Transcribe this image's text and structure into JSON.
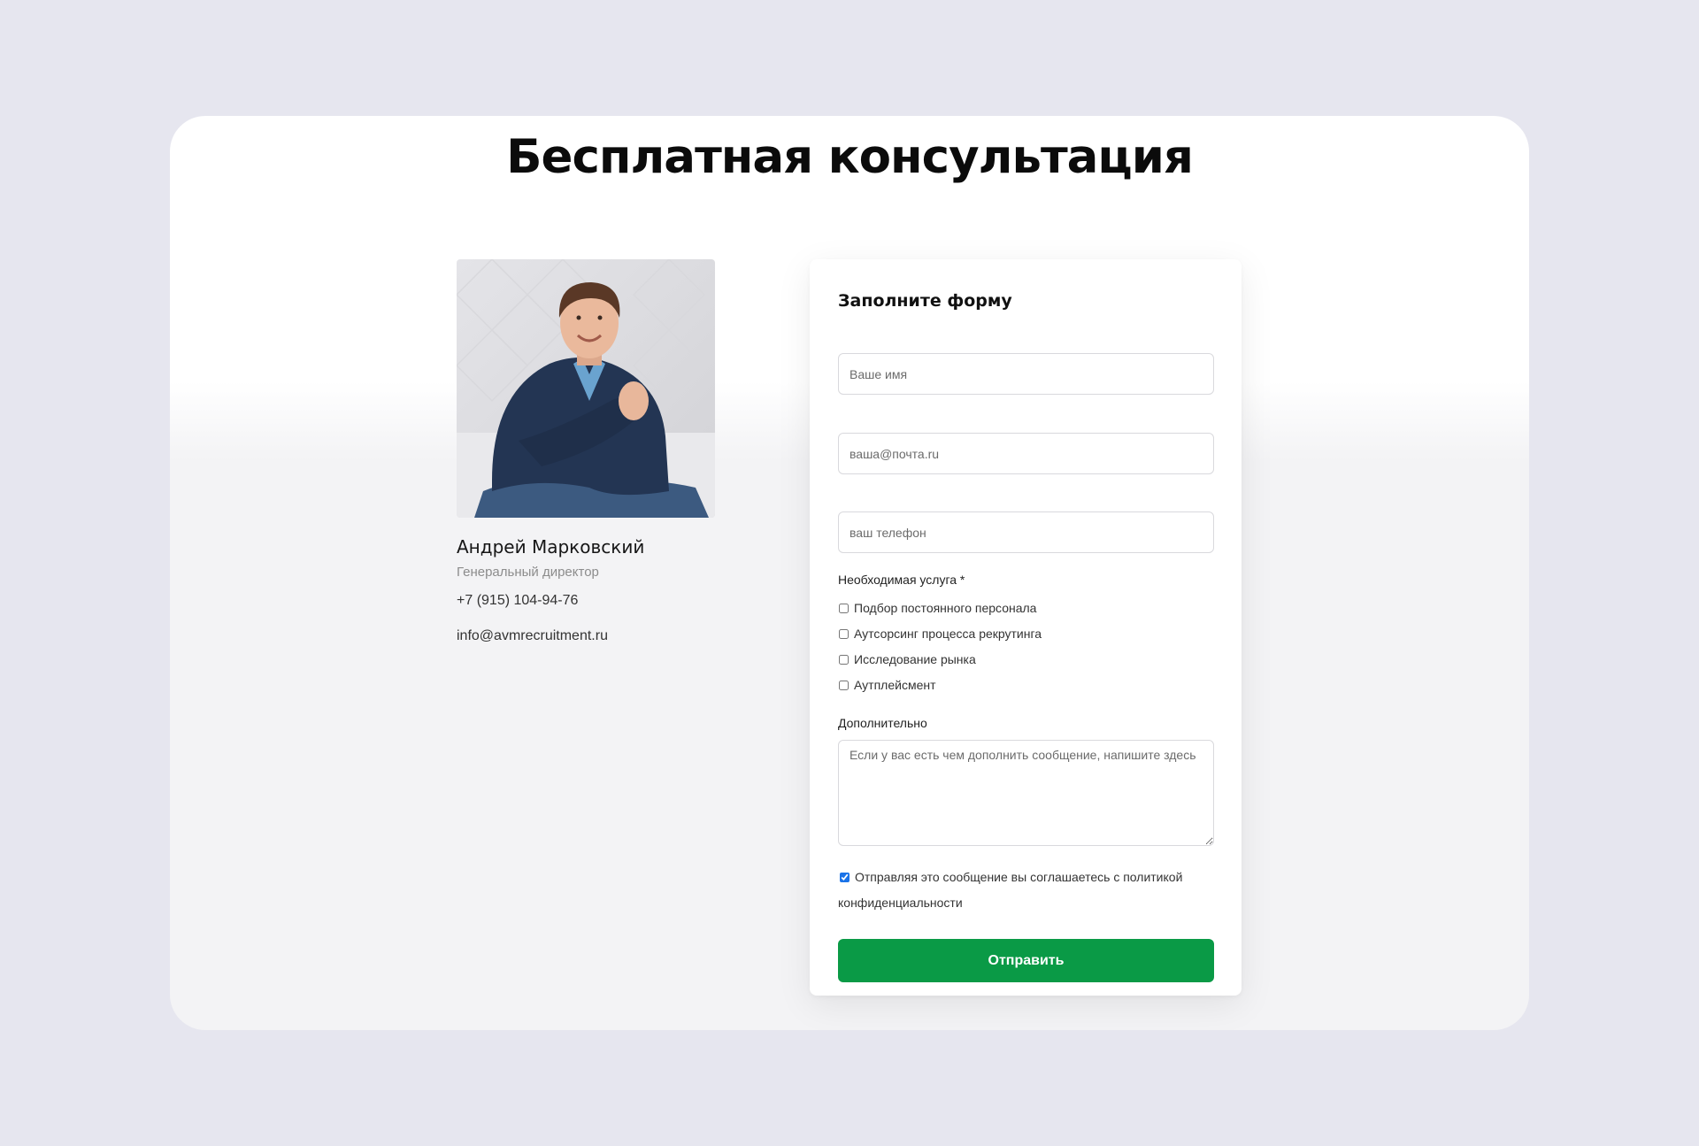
{
  "page": {
    "title": "Бесплатная консультация"
  },
  "person": {
    "name": "Андрей Марковский",
    "role": "Генеральный директор",
    "phone": "+7 (915) 104-94-76",
    "email": "info@avmrecruitment.ru"
  },
  "form": {
    "title": "Заполните форму",
    "name_placeholder": "Ваше имя",
    "email_placeholder": "ваша@почта.ru",
    "phone_placeholder": "ваш телефон",
    "service_label": "Необходимая услуга *",
    "services": [
      {
        "label": "Подбор постоянного персонала",
        "checked": false
      },
      {
        "label": "Аутсорсинг процесса рекрутинга",
        "checked": false
      },
      {
        "label": "Исследование рынка",
        "checked": false
      },
      {
        "label": "Аутплейсмент",
        "checked": false
      }
    ],
    "extra_label": "Дополнительно",
    "extra_placeholder": "Если у вас есть чем дополнить сообщение, напишите здесь",
    "consent_text": "Отправляя это сообщение вы соглашаетесь с политикой конфиденциальности",
    "consent_checked": true,
    "submit_label": "Отправить"
  },
  "colors": {
    "background": "#e6e6ef",
    "submit_button": "#0a9a46",
    "checkbox_accent": "#1a73e8"
  }
}
